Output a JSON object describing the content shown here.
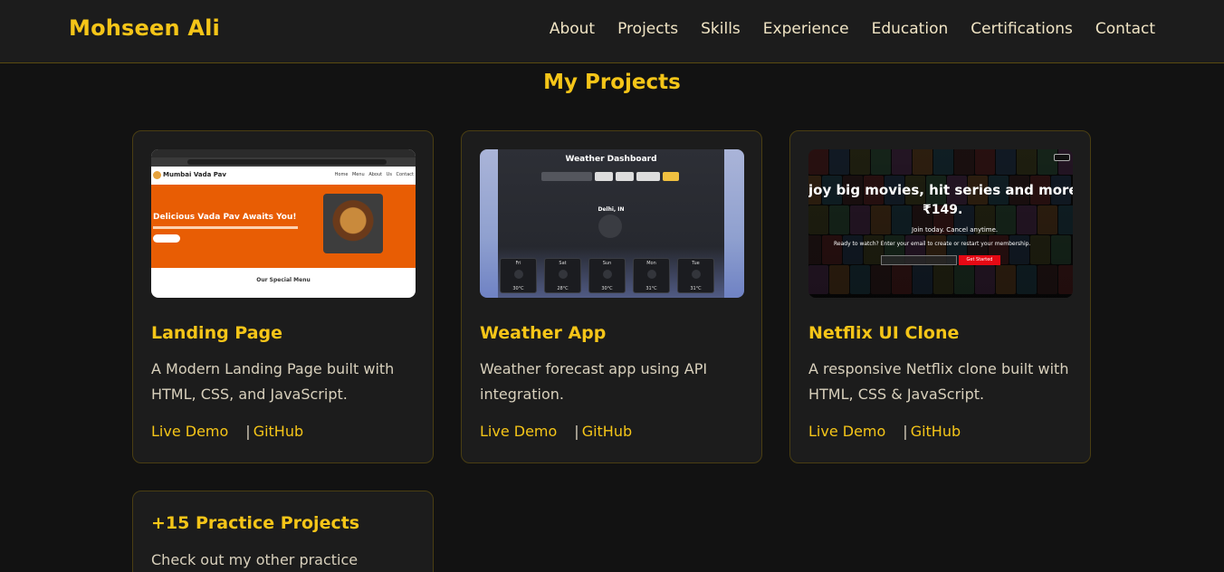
{
  "header": {
    "brand": "Mohseen Ali",
    "nav": [
      "About",
      "Projects",
      "Skills",
      "Experience",
      "Education",
      "Certifications",
      "Contact"
    ]
  },
  "section": {
    "title": "My Projects"
  },
  "projects": [
    {
      "title": "Landing Page",
      "description": "A Modern Landing Page built with HTML, CSS, and JavaScript.",
      "live_label": "Live Demo",
      "separator": "|",
      "github_label": "GitHub",
      "thumb": {
        "site_name": "Mumbai Vada Pav",
        "menu_items": "Home Menu About Us Contact",
        "hero_heading": "Delicious Vada Pav Awaits You!",
        "section_heading": "Our Special Menu"
      }
    },
    {
      "title": "Weather App",
      "description": "Weather forecast app using API integration.",
      "live_label": "Live Demo",
      "separator": "|",
      "github_label": "GitHub",
      "thumb": {
        "heading": "Weather Dashboard",
        "city": "Delhi, IN",
        "days": [
          "Fri",
          "Sat",
          "Sun",
          "Mon",
          "Tue"
        ],
        "temps": [
          "30°C",
          "28°C",
          "30°C",
          "31°C",
          "31°C"
        ]
      }
    },
    {
      "title": "Netflix UI Clone",
      "description": "A responsive Netflix clone built with HTML, CSS & JavaScript.",
      "live_label": "Live Demo",
      "separator": "|",
      "github_label": "GitHub",
      "thumb": {
        "headline": "joy big movies, hit series and more fro",
        "price": "₹149.",
        "sub1": "Join today. Cancel anytime.",
        "sub2": "Ready to watch? Enter your email to create or restart your membership.",
        "cta": "Get Started"
      }
    }
  ],
  "practice": {
    "title": "+15 Practice Projects",
    "description": "Check out my other practice"
  },
  "colors": {
    "accent": "#f5c518",
    "background": "#121212",
    "card": "#1c1c1c"
  }
}
